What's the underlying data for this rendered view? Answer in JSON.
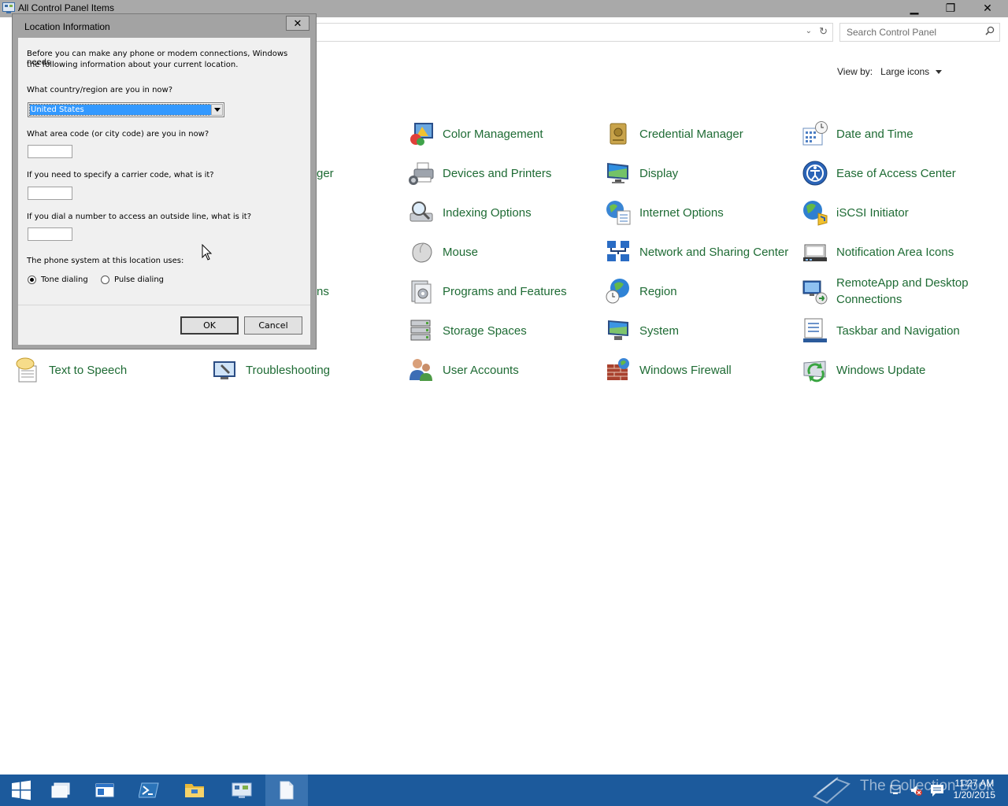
{
  "window": {
    "title": "All Control Panel Items",
    "minimize": "▁",
    "maximize": "❐",
    "close": "✕"
  },
  "addressbar": {
    "dropdown": "⌄",
    "refresh": "↻"
  },
  "search": {
    "placeholder": "Search Control Panel"
  },
  "viewby": {
    "label": "View by:",
    "value": "Large icons"
  },
  "items": [
    {
      "label": "Color Management",
      "icon": "color-management-icon"
    },
    {
      "label": "Credential Manager",
      "icon": "credential-manager-icon"
    },
    {
      "label": "Date and Time",
      "icon": "date-time-icon"
    },
    {
      "label": "ger",
      "icon": ""
    },
    {
      "label": "Devices and Printers",
      "icon": "devices-printers-icon"
    },
    {
      "label": "Display",
      "icon": "display-icon"
    },
    {
      "label": "Ease of Access Center",
      "icon": "ease-of-access-icon"
    },
    {
      "label": "Indexing Options",
      "icon": "indexing-options-icon"
    },
    {
      "label": "Internet Options",
      "icon": "internet-options-icon"
    },
    {
      "label": "iSCSI Initiator",
      "icon": "iscsi-initiator-icon"
    },
    {
      "label": "Mouse",
      "icon": "mouse-icon"
    },
    {
      "label": "Network and Sharing Center",
      "icon": "network-sharing-icon"
    },
    {
      "label": "Notification Area Icons",
      "icon": "notification-area-icon"
    },
    {
      "label": "ns",
      "icon": ""
    },
    {
      "label": "Programs and Features",
      "icon": "programs-features-icon"
    },
    {
      "label": "Region",
      "icon": "region-icon"
    },
    {
      "label": "RemoteApp and Desktop Connections",
      "icon": "remoteapp-icon"
    },
    {
      "label": "Storage Spaces",
      "icon": "storage-spaces-icon"
    },
    {
      "label": "System",
      "icon": "system-icon"
    },
    {
      "label": "Taskbar and Navigation",
      "icon": "taskbar-navigation-icon"
    },
    {
      "label": "Text to Speech",
      "icon": "text-to-speech-icon"
    },
    {
      "label": "Troubleshooting",
      "icon": "troubleshooting-icon"
    },
    {
      "label": "User Accounts",
      "icon": "user-accounts-icon"
    },
    {
      "label": "Windows Firewall",
      "icon": "windows-firewall-icon"
    },
    {
      "label": "Windows Update",
      "icon": "windows-update-icon"
    }
  ],
  "dialog": {
    "title": "Location Information",
    "close": "✕",
    "intro_line1": "Before you can make any phone or modem connections, Windows needs",
    "intro_line2": "the following information about your current location.",
    "country_q": "What country/region are you in now?",
    "country_value": "United States",
    "area_q": "What area code (or city code) are you in now?",
    "area_value": "",
    "carrier_q": "If you need to specify a carrier code, what is it?",
    "carrier_value": "",
    "outside_q": "If you dial a number to access an outside line, what is it?",
    "outside_value": "",
    "phone_system_q": "The phone system at this location uses:",
    "tone_label": "Tone dialing",
    "tone_selected": true,
    "pulse_label": "Pulse dialing",
    "pulse_selected": false,
    "ok": "OK",
    "cancel": "Cancel"
  },
  "taskbar": {
    "time": "11:27 AM",
    "date": "1/20/2015",
    "watermark": "The Collection Book"
  },
  "colors": {
    "link_green": "#1e6b34",
    "taskbar_blue": "#1c5a9c",
    "selection_blue": "#3399ff"
  }
}
